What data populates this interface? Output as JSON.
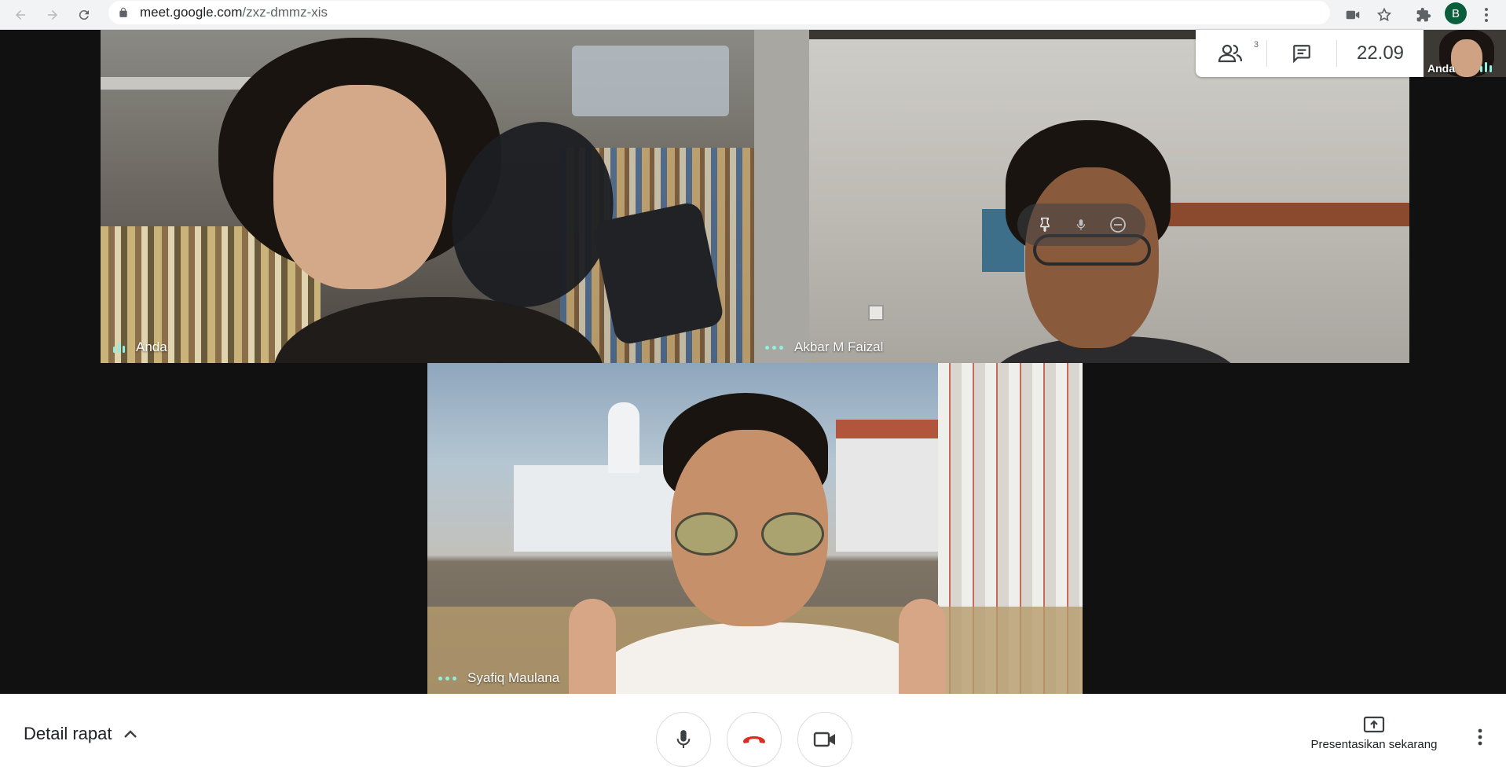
{
  "browser": {
    "url_host": "meet.google.com",
    "url_path": "/zxz-dmmz-xis",
    "profile_initial": "B",
    "icons": [
      "back-icon",
      "forward-icon",
      "reload-icon",
      "lock-icon",
      "camera-icon",
      "star-icon",
      "extensions-icon"
    ]
  },
  "participants": [
    {
      "name": "Anda",
      "indicator": "speaking"
    },
    {
      "name": "Akbar M Faizal",
      "indicator": "dots"
    },
    {
      "name": "Syafiq Maulana",
      "indicator": "dots"
    }
  ],
  "tile_controls": [
    "pin-icon",
    "mic-icon",
    "remove-icon"
  ],
  "info_panel": {
    "people_count": "3",
    "clock": "22.09"
  },
  "self_view": {
    "label": "Anda"
  },
  "bottom_bar": {
    "details_label": "Detail rapat",
    "present_label": "Presentasikan sekarang"
  },
  "colors": {
    "accent_teal": "#8ef0e1",
    "hangup_red": "#d93025",
    "background": "#111111"
  }
}
